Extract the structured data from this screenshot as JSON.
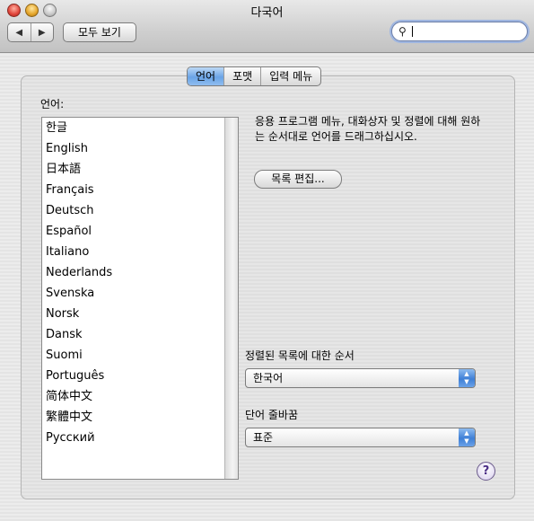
{
  "window": {
    "title": "다국어"
  },
  "toolbar": {
    "back_icon": "◀",
    "forward_icon": "▶",
    "show_all_label": "모두 보기",
    "search_value": ""
  },
  "tabs": [
    {
      "label": "언어",
      "active": true
    },
    {
      "label": "포맷",
      "active": false
    },
    {
      "label": "입력 메뉴",
      "active": false
    }
  ],
  "languages": {
    "label": "언어:",
    "items": [
      "한글",
      "English",
      "日本語",
      "Français",
      "Deutsch",
      "Español",
      "Italiano",
      "Nederlands",
      "Svenska",
      "Norsk",
      "Dansk",
      "Suomi",
      "Português",
      "简体中文",
      "繁體中文",
      "Русский"
    ]
  },
  "instructions": "응용 프로그램 메뉴, 대화상자 및 정렬에 대해 원하는 순서대로 언어를 드래그하십시오.",
  "edit_list_label": "목록 편집...",
  "sort_order": {
    "label": "정렬된 목록에 대한 순서",
    "value": "한국어"
  },
  "word_break": {
    "label": "단어 줄바꿈",
    "value": "표준"
  },
  "help_label": "?",
  "colors": {
    "accent": "#5d97e6",
    "panel": "#e4e4e4"
  }
}
